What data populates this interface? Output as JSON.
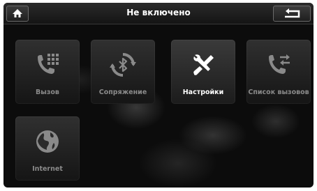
{
  "header": {
    "title": "Не включено",
    "home_icon": "home-icon",
    "back_icon": "back-arrow-icon"
  },
  "tiles": [
    {
      "label": "Вызов",
      "icon": "phone-dialpad-icon",
      "active": false
    },
    {
      "label": "Сопряжение",
      "icon": "bluetooth-sync-icon",
      "active": false
    },
    {
      "label": "Настройки",
      "icon": "settings-tools-icon",
      "active": true
    },
    {
      "label": "Список вызовов",
      "icon": "call-log-icon",
      "active": false
    },
    {
      "label": "Internet",
      "icon": "globe-icon",
      "active": false
    }
  ],
  "colors": {
    "background": "#0c0c0c",
    "label_inactive": "#8a8a8a",
    "label_active": "#ffffff"
  }
}
